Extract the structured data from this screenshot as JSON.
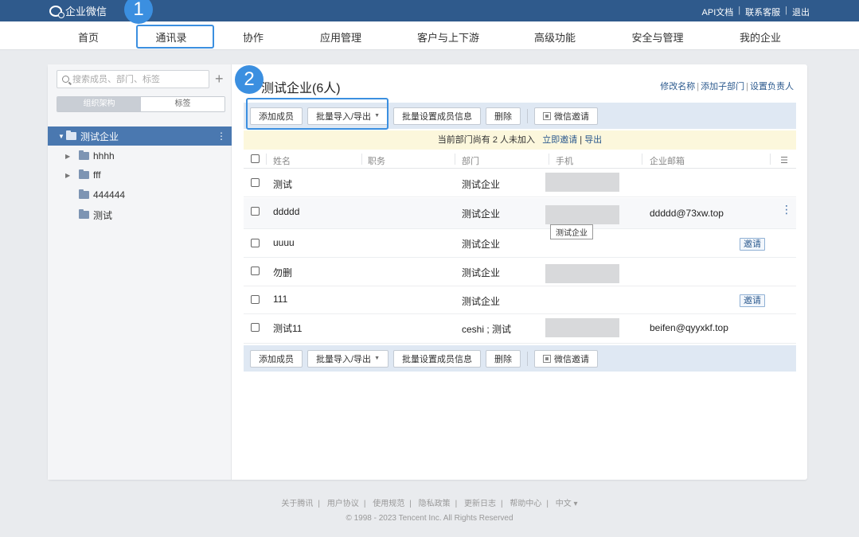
{
  "topbar": {
    "logo_text": "企业微信",
    "links": [
      "API文档",
      "联系客服",
      "退出"
    ]
  },
  "nav": {
    "items": [
      "首页",
      "通讯录",
      "协作",
      "应用管理",
      "客户与上下游",
      "高级功能",
      "安全与管理",
      "我的企业"
    ]
  },
  "annotations": {
    "badge1": "1",
    "badge2": "2"
  },
  "sidebar": {
    "search_placeholder": "搜索成员、部门、标签",
    "add_symbol": "+",
    "tabs": [
      "组织架构",
      "标签"
    ],
    "tree": [
      {
        "label": "测试企业",
        "caret": "▼",
        "selected": true
      },
      {
        "label": "hhhh",
        "caret": "▶"
      },
      {
        "label": "fff",
        "caret": "▶"
      },
      {
        "label": "444444",
        "caret": ""
      },
      {
        "label": "测试",
        "caret": ""
      }
    ]
  },
  "main": {
    "title": "测试企业(6人)",
    "title_links": [
      "修改名称",
      "添加子部门",
      "设置负责人"
    ],
    "toolbar": {
      "add_member": "添加成员",
      "batch_import": "批量导入/导出",
      "batch_import_arrow": "▼",
      "batch_set": "批量设置成员信息",
      "delete": "删除",
      "wechat_invite": "微信邀请"
    },
    "notice": {
      "text": "当前部门尚有 2 人未加入",
      "invite_link": "立即邀请",
      "sep": "|",
      "export_link": "导出"
    },
    "columns": [
      "姓名",
      "职务",
      "部门",
      "手机",
      "企业邮箱"
    ],
    "column_menu_icon": "☰",
    "rows": [
      {
        "name": "测试",
        "dept": "测试企业",
        "phone_hidden": true,
        "email": "",
        "invite": ""
      },
      {
        "name": "ddddd",
        "dept": "测试企业",
        "phone_hidden": true,
        "email": "ddddd@73xw.top",
        "invite": "",
        "tooltip": "测试企业"
      },
      {
        "name": "uuuu",
        "dept": "测试企业",
        "phone_hidden": false,
        "email": "",
        "invite": "邀请"
      },
      {
        "name": "勿删",
        "dept": "测试企业",
        "phone_hidden": true,
        "email": "",
        "invite": ""
      },
      {
        "name": "111",
        "dept": "测试企业",
        "phone_hidden": false,
        "email": "",
        "invite": "邀请"
      },
      {
        "name": "测试11",
        "dept": "ceshi ; 测试",
        "phone_hidden": true,
        "email": "beifen@qyyxkf.top",
        "invite": ""
      }
    ],
    "row_menu_icon": "⋮"
  },
  "footer": {
    "links": [
      "关于腾讯",
      "用户协议",
      "使用规范",
      "隐私政策",
      "更新日志",
      "帮助中心",
      "中文 ▾"
    ],
    "copyright": "© 1998 - 2023 Tencent Inc. All Rights Reserved"
  }
}
